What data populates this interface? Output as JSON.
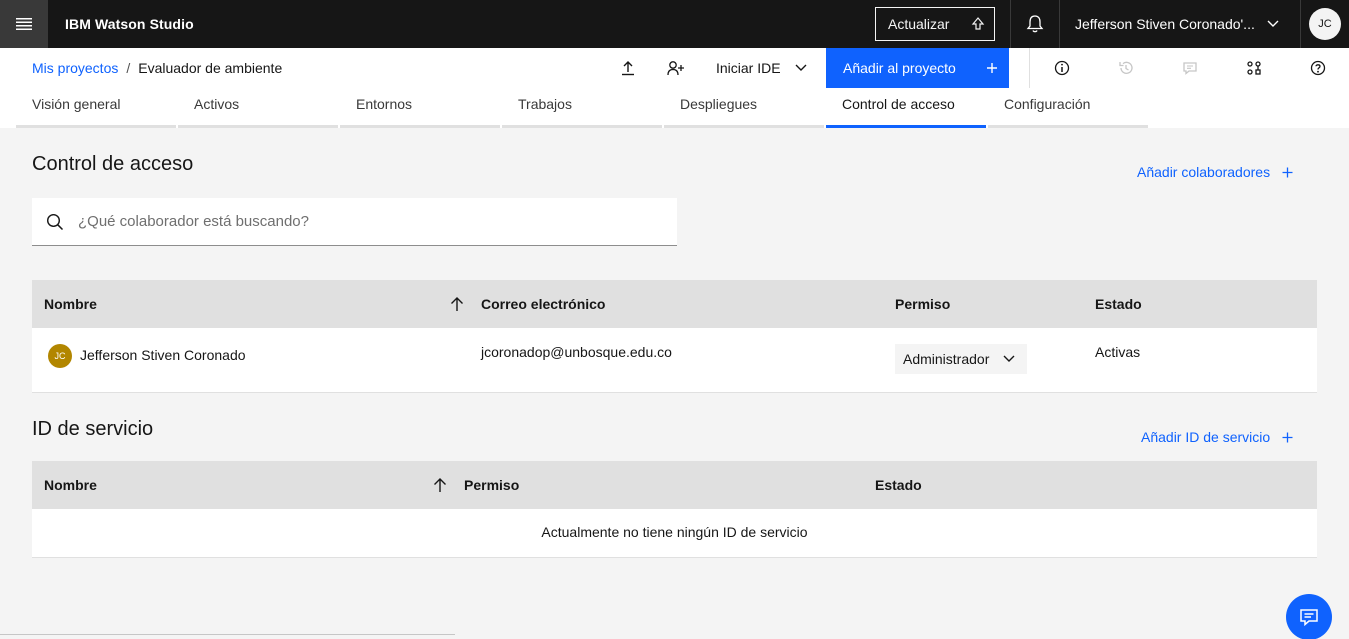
{
  "header": {
    "brand": "IBM Watson Studio",
    "update_label": "Actualizar",
    "user_name": "Jefferson Stiven Coronado'...",
    "user_initials": "JC"
  },
  "breadcrumb": {
    "parent": "Mis proyectos",
    "separator": "/",
    "current": "Evaluador de ambiente"
  },
  "toolbar": {
    "ide_label": "Iniciar IDE",
    "add_to_project_label": "Añadir al proyecto"
  },
  "tabs": [
    {
      "label": "Visión general"
    },
    {
      "label": "Activos"
    },
    {
      "label": "Entornos"
    },
    {
      "label": "Trabajos"
    },
    {
      "label": "Despliegues"
    },
    {
      "label": "Control de acceso"
    },
    {
      "label": "Configuración"
    }
  ],
  "access": {
    "title": "Control de acceso",
    "add_label": "Añadir colaboradores",
    "search_placeholder": "¿Qué colaborador está buscando?",
    "columns": {
      "name": "Nombre",
      "email": "Correo electrónico",
      "permission": "Permiso",
      "status": "Estado"
    },
    "rows": [
      {
        "initials": "JC",
        "name": "Jefferson Stiven Coronado",
        "email": "jcoronadop@unbosque.edu.co",
        "permission": "Administrador",
        "status": "Activas"
      }
    ]
  },
  "service": {
    "title": "ID de servicio",
    "add_label": "Añadir ID de servicio",
    "columns": {
      "name": "Nombre",
      "permission": "Permiso",
      "status": "Estado"
    },
    "empty_message": "Actualmente no tiene ningún ID de servicio"
  },
  "colors": {
    "accent": "#0f62fe",
    "header_bg": "#161616",
    "avatar_user": "#b28600"
  }
}
